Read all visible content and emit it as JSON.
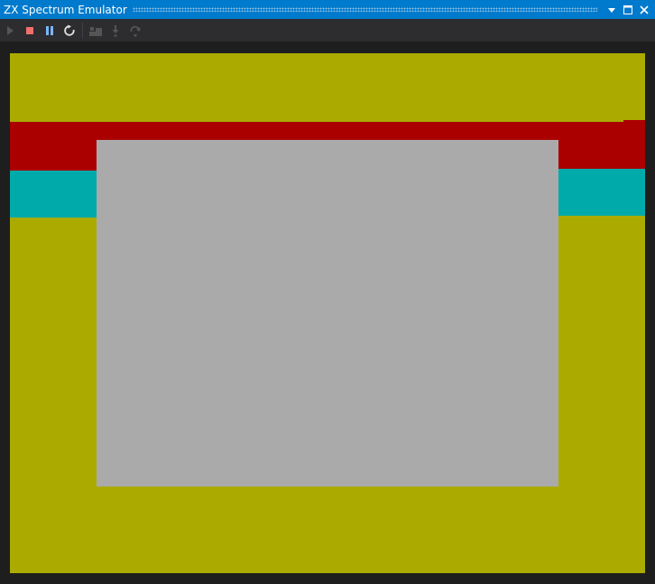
{
  "window": {
    "title": "ZX Spectrum Emulator",
    "accent_color": "#007acc"
  },
  "title_buttons": [
    {
      "name": "dropdown-arrow-icon"
    },
    {
      "name": "maximize-icon"
    },
    {
      "name": "close-icon"
    }
  ],
  "toolbar": {
    "items": [
      {
        "name": "play-icon",
        "enabled": false,
        "color": "#555555"
      },
      {
        "name": "stop-icon",
        "enabled": true,
        "color": "#f1706c"
      },
      {
        "name": "pause-icon",
        "enabled": true,
        "color": "#7ab6ff"
      },
      {
        "name": "restart-icon",
        "enabled": true,
        "color": "#e0e0e0"
      },
      {
        "name": "step-over-icon",
        "enabled": false,
        "color": "#555555"
      },
      {
        "name": "step-into-icon",
        "enabled": false,
        "color": "#555555"
      },
      {
        "name": "step-out-icon",
        "enabled": false,
        "color": "#555555"
      }
    ]
  },
  "emulator_screen": {
    "border_color": "#aaaa00",
    "paper_color": "#aaaaaa",
    "border_bands": [
      {
        "color": "#aa0000"
      },
      {
        "color": "#00aaaa"
      }
    ]
  }
}
